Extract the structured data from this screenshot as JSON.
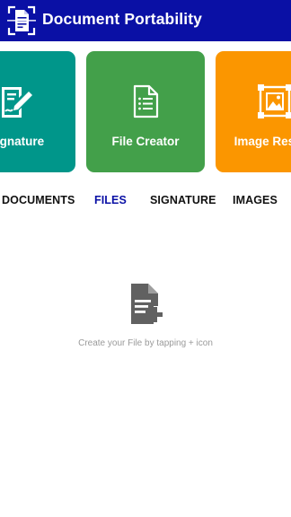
{
  "header": {
    "title": "Document Portability",
    "logo_icon": "scan-document-icon",
    "background_color": "#0a10a5"
  },
  "cards": [
    {
      "label": "Signature",
      "icon": "signature-icon",
      "color": "#00968a"
    },
    {
      "label": "File Creator",
      "icon": "file-document-icon",
      "color": "#43a04a"
    },
    {
      "label": "Image Resizer",
      "icon": "image-resize-icon",
      "color": "#fb9600"
    }
  ],
  "tabs": [
    {
      "label": "DOCUMENTS",
      "active": false
    },
    {
      "label": "FILES",
      "active": true
    },
    {
      "label": "SIGNATURE",
      "active": false
    },
    {
      "label": "IMAGES",
      "active": false
    }
  ],
  "empty_state": {
    "icon": "file-add-icon",
    "message": "Create your File by tapping + icon"
  },
  "colors": {
    "accent": "#0a10a5",
    "muted_text": "#9a9a9a",
    "icon_gray": "#616161"
  }
}
